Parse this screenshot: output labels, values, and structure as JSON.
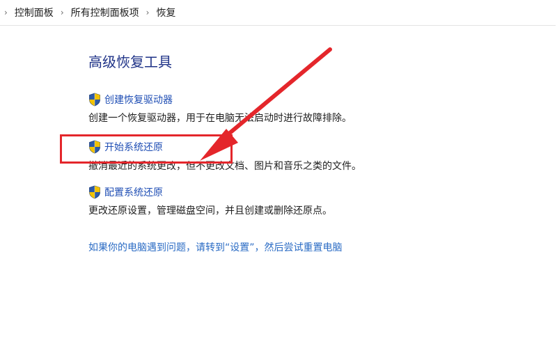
{
  "breadcrumb": {
    "items": [
      "控制面板",
      "所有控制面板项",
      "恢复"
    ],
    "separator_icon": "chevron-right-icon"
  },
  "page": {
    "title": "高级恢复工具"
  },
  "options": [
    {
      "link": "创建恢复驱动器",
      "description": "创建一个恢复驱动器，用于在电脑无法启动时进行故障排除。",
      "icon": "uac-shield-icon"
    },
    {
      "link": "开始系统还原",
      "description": "撤消最近的系统更改，但不更改文档、图片和音乐之类的文件。",
      "icon": "uac-shield-icon"
    },
    {
      "link": "配置系统还原",
      "description": "更改还原设置，管理磁盘空间，并且创建或删除还原点。",
      "icon": "uac-shield-icon"
    }
  ],
  "footer_link": "如果你的电脑遇到问题，请转到“设置”，然后尝试重置电脑",
  "colors": {
    "title": "#1e3287",
    "link": "#1f4eb4",
    "footer_link": "#2a6bc4",
    "annotation": "#e4262b",
    "shield_blue": "#2c5aa8",
    "shield_yellow": "#f2c200"
  }
}
